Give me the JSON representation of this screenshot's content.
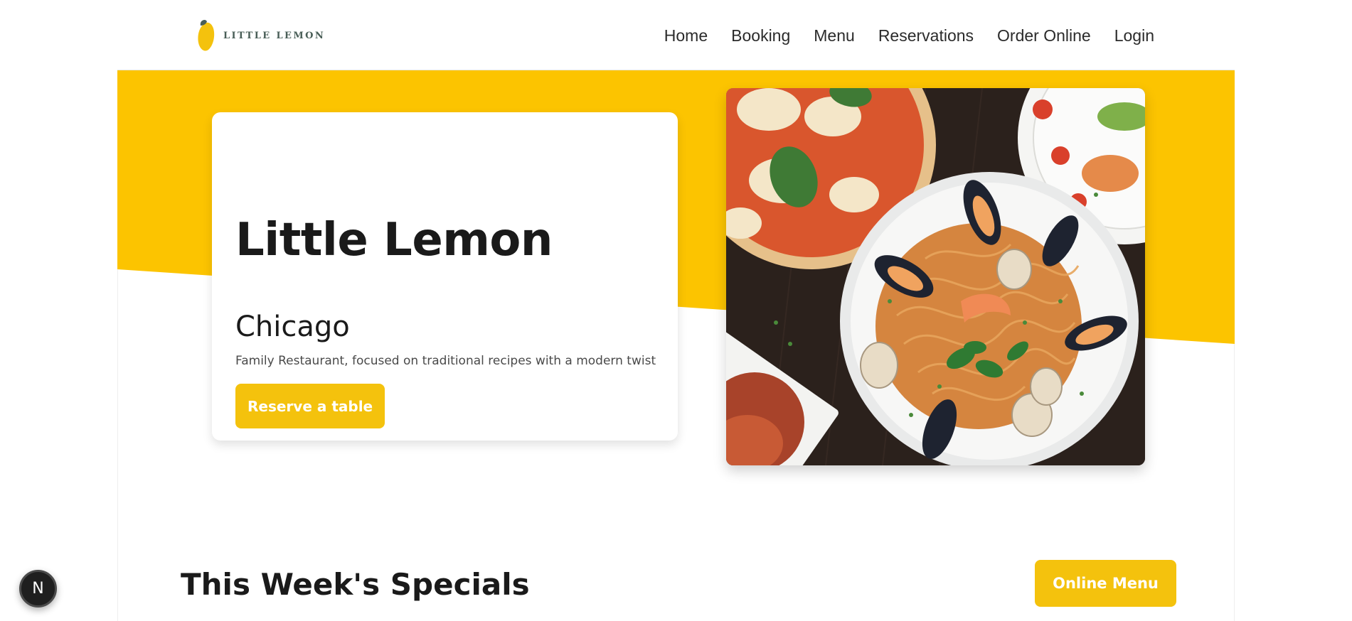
{
  "brand": {
    "logo_text": "LITTLE LEMON",
    "logo_icon": "lemon-icon"
  },
  "nav": {
    "items": [
      {
        "label": "Home"
      },
      {
        "label": "Booking"
      },
      {
        "label": "Menu"
      },
      {
        "label": "Reservations"
      },
      {
        "label": "Order Online"
      },
      {
        "label": "Login"
      }
    ]
  },
  "hero": {
    "title": "Little Lemon",
    "city": "Chicago",
    "description": "Family Restaurant, focused on traditional recipes with a modern twist",
    "reserve_label": "Reserve a table",
    "image_subject": "seafood pasta and pizza",
    "image_alt": "Spaghetti with mussels, clams and shrimp next to a margherita pizza"
  },
  "specials": {
    "title": "This Week's Specials",
    "online_menu_label": "Online Menu"
  },
  "dev_indicator": {
    "label": "N"
  },
  "colors": {
    "accent": "#F4C20D",
    "hero_band": "#FCC400",
    "text_dark": "#1A1A1A",
    "brand_green": "#495E57"
  }
}
